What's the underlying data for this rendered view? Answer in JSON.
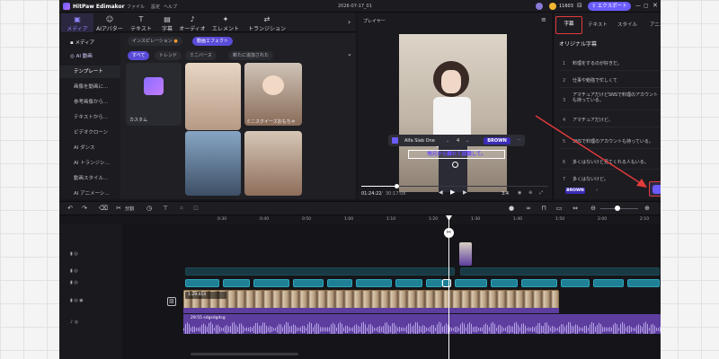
{
  "app": {
    "name": "HitPaw Edimakor",
    "menu": [
      "ファイル",
      "設定",
      "ヘルプ"
    ],
    "project_title": "2026-07-17_01",
    "credits": "11603",
    "export_button": "エクスポート"
  },
  "toolbar": {
    "tools": [
      "メディア",
      "AIアバター",
      "テキスト",
      "字幕",
      "オーディオ",
      "エレメント",
      "トランジション"
    ]
  },
  "sidebar": {
    "items": [
      "メディア",
      "AI 動画",
      "テンプレート",
      "画像を動画に...",
      "参考画像から...",
      "テキストから...",
      "ビデオクローン",
      "AI ダンス",
      "AI トランジシ...",
      "動画スタイル...",
      "AI アニメーシ..."
    ]
  },
  "library": {
    "top_tabs": [
      "インスピレーション",
      "動画エフェクト"
    ],
    "filters": [
      "すべて",
      "トレンド",
      "ミニバース",
      "新たに追加された"
    ],
    "items": [
      "カスタム",
      "ミニスクイーズおもちゃ"
    ]
  },
  "player": {
    "label": "プレイヤー",
    "current_time": "01:24:22",
    "total_time": "30:17:08",
    "aspect": "3:4",
    "font_name": "Alfa Slab One",
    "font_size": "4",
    "style_tag": "BROWN",
    "caption_text": "地元から離れて就職して。"
  },
  "panel": {
    "tabs": [
      "字幕",
      "テキスト",
      "スタイル",
      "アニメーション"
    ],
    "title": "オリジナル字幕",
    "subtitles": [
      {
        "n": "1",
        "text": "料理をするのが好きだ。"
      },
      {
        "n": "2",
        "text": "仕事や勉強で忙しくて"
      },
      {
        "n": "3",
        "text": "アマチュアだけどSNSで料理のアカウントも持っている。"
      },
      {
        "n": "4",
        "text": "アマチュアだけど。"
      },
      {
        "n": "5",
        "text": "SNSで料理のアカウントも持っている。"
      },
      {
        "n": "6",
        "text": "多くはないけど見てくれる人もいる。"
      },
      {
        "n": "7",
        "text": "多くはないけど。"
      }
    ],
    "footer_tag": "BROWN",
    "export_subtitles": "字幕をエクスポート"
  },
  "timeline": {
    "split_label": "分割",
    "ruler": [
      "0:30",
      "0:40",
      "0:50",
      "1:00",
      "1:10",
      "1:20",
      "1:30",
      "1:40",
      "1:50",
      "2:00",
      "2:10",
      "2:20",
      "2:30"
    ],
    "video_clip": "1:29.414",
    "audio_clip": "29:55 sdgsdgdsg"
  },
  "colors": {
    "accent": "#6b5cff",
    "highlight": "#e23b3b",
    "text_clip": "#1e7f95",
    "audio_clip": "#5d3e9e"
  }
}
